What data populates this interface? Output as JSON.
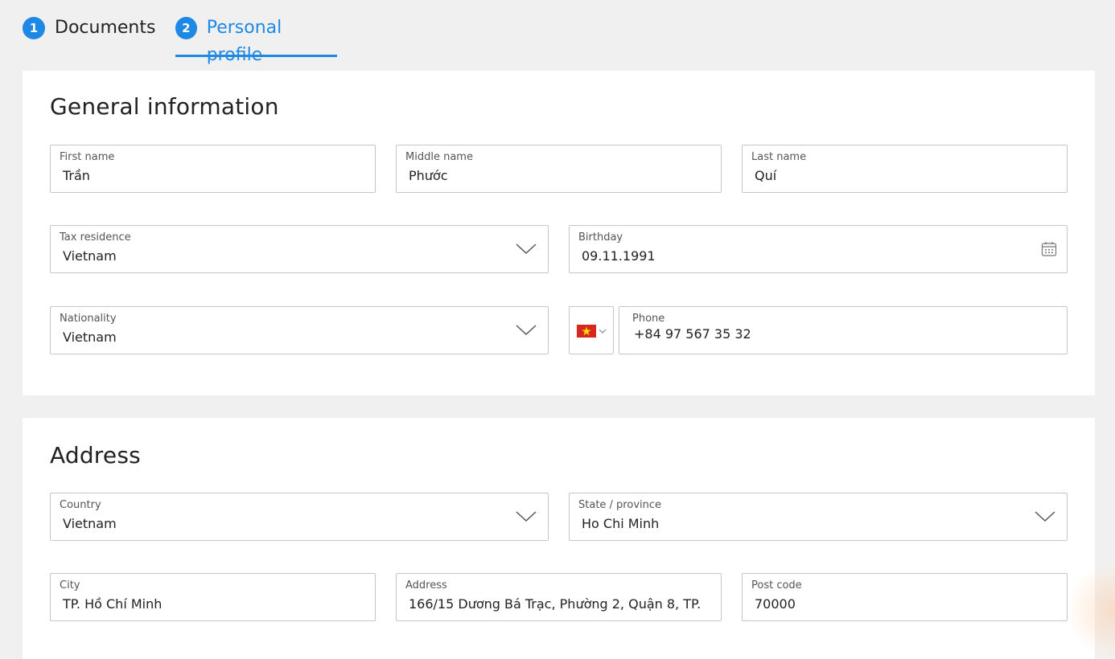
{
  "stepper": {
    "steps": [
      {
        "number": "1",
        "label": "Documents",
        "active": false
      },
      {
        "number": "2",
        "label": "Personal profile",
        "active": true
      }
    ]
  },
  "general": {
    "title": "General information",
    "first_name": {
      "label": "First name",
      "value": "Trần"
    },
    "middle_name": {
      "label": "Middle name",
      "value": "Phước"
    },
    "last_name": {
      "label": "Last name",
      "value": "Quí"
    },
    "tax_residence": {
      "label": "Tax residence",
      "value": "Vietnam"
    },
    "birthday": {
      "label": "Birthday",
      "value": "09.11.1991",
      "icon": "calendar-icon"
    },
    "nationality": {
      "label": "Nationality",
      "value": "Vietnam"
    },
    "phone": {
      "label": "Phone",
      "value": "+84 97 567 35 32",
      "flag_icon": "vietnam-flag-icon"
    }
  },
  "address": {
    "title": "Address",
    "country": {
      "label": "Country",
      "value": "Vietnam"
    },
    "state": {
      "label": "State / province",
      "value": "Ho Chi Minh"
    },
    "city": {
      "label": "City",
      "value": "TP. Hồ Chí Minh"
    },
    "address": {
      "label": "Address",
      "value": "166/15 Dương Bá Trạc, Phường 2, Quận 8, TP."
    },
    "post_code": {
      "label": "Post code",
      "value": "70000"
    }
  },
  "colors": {
    "accent": "#1e88e5",
    "background": "#f0f0f0",
    "border": "#c6c6c6",
    "flag_red": "#d8271f",
    "flag_star": "#ffde00"
  }
}
